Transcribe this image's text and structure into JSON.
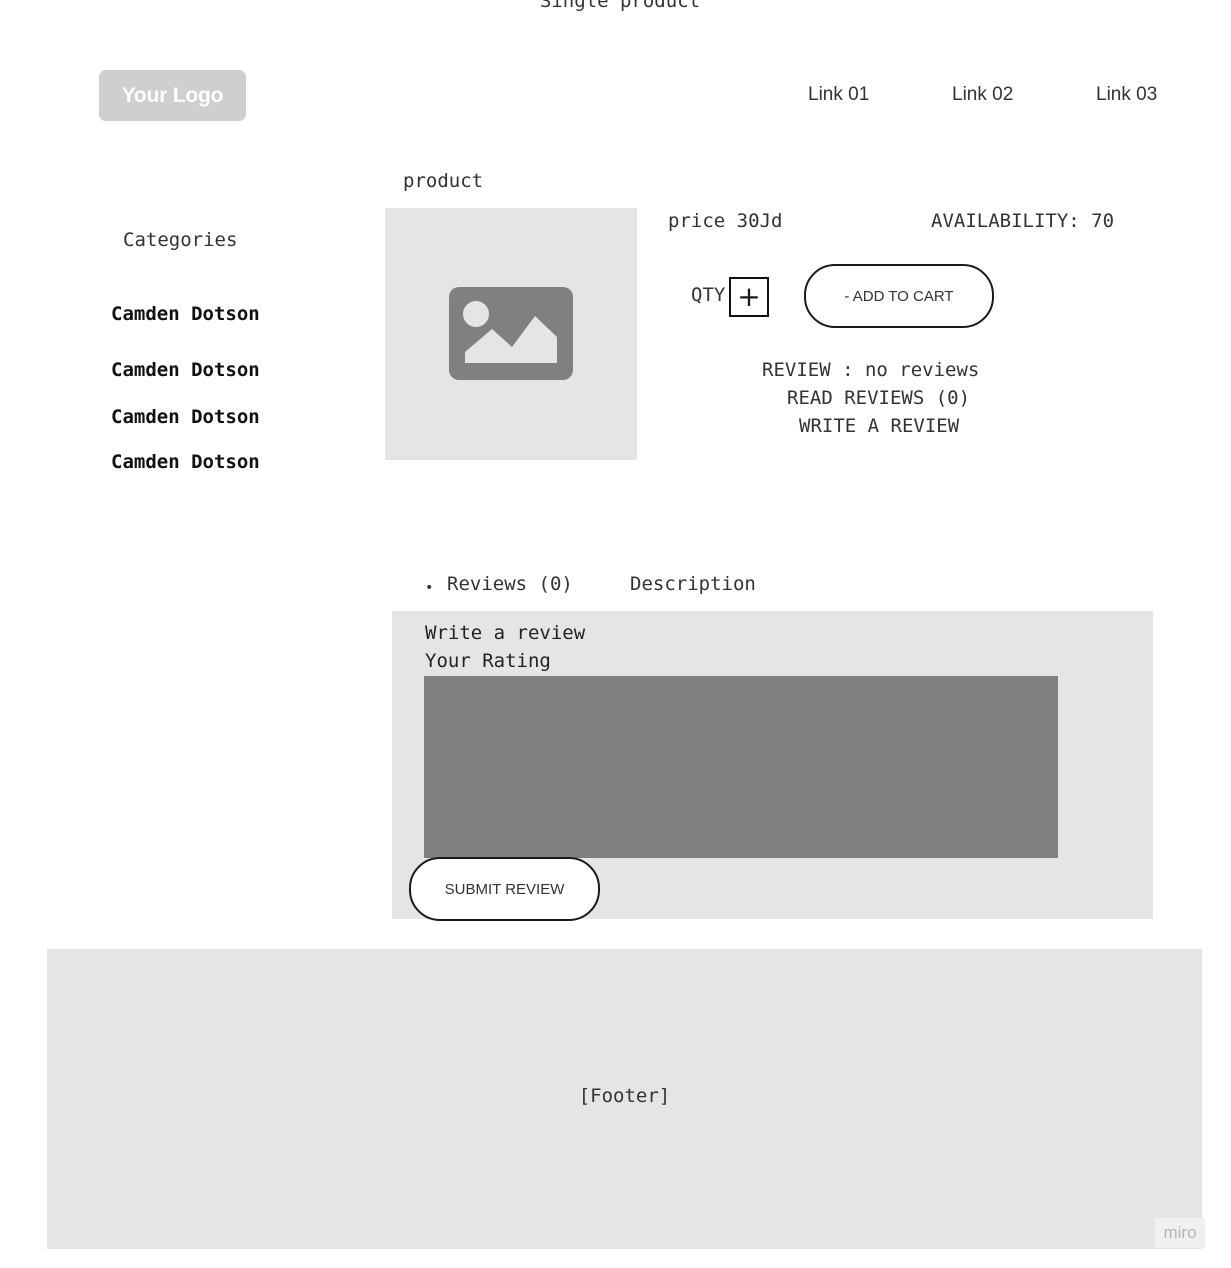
{
  "page_title": "Single product",
  "header": {
    "logo_text": "Your Logo",
    "nav_links": [
      "Link 01",
      "Link 02",
      "Link 03"
    ]
  },
  "sidebar": {
    "title": "Categories",
    "items": [
      "Camden Dotson",
      "Camden Dotson",
      "Camden Dotson",
      "Camden Dotson"
    ]
  },
  "product": {
    "heading": "product",
    "image_icon": "image-placeholder-icon",
    "price": "price 30Jd",
    "availability": "AVAILABILITY: 70",
    "qty_label": "QTY",
    "qty_plus_glyph": "+",
    "add_to_cart_label": "- ADD TO CART",
    "review_summary": "REVIEW : no reviews",
    "read_reviews": "READ REVIEWS (0)",
    "write_review": "WRITE A REVIEW"
  },
  "tabs": {
    "bullet": "•",
    "reviews_tab": "Reviews (0)",
    "description_tab": "Description"
  },
  "review_form": {
    "heading": "Write a review",
    "rating_label": "Your Rating",
    "submit_label": "SUBMIT REVIEW"
  },
  "footer": {
    "text": "[Footer]"
  },
  "badge": {
    "text": "miro"
  },
  "colors": {
    "placeholder_gray": "#e5e5e5",
    "dark_gray": "#808080",
    "logo_gray": "#cfcfcf"
  }
}
